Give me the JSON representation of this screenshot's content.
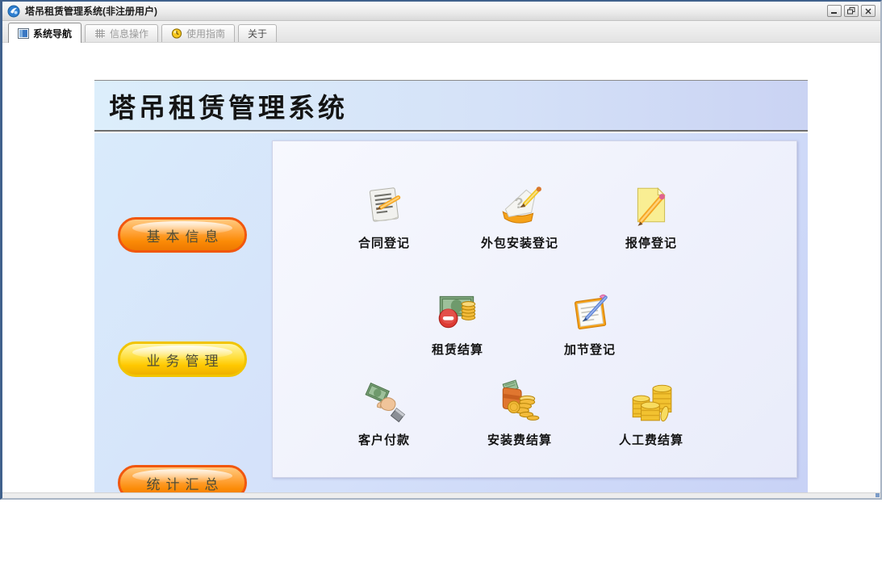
{
  "window": {
    "title": "塔吊租赁管理系统(非注册用户)",
    "app_icon": "blue-globe-icon",
    "controls": [
      {
        "name": "minimize-button",
        "glyph": "−"
      },
      {
        "name": "restore-button",
        "glyph": "❐"
      },
      {
        "name": "close-button",
        "glyph": "×"
      }
    ]
  },
  "tabs": [
    {
      "label": "系统导航",
      "icon": "blue-panel-icon",
      "active": true
    },
    {
      "label": "信息操作",
      "icon": "grid-icon",
      "active": false
    },
    {
      "label": "使用指南",
      "icon": "yellow-ball-icon",
      "active": false
    },
    {
      "label": "关于",
      "icon": "",
      "active": false
    }
  ],
  "banner": {
    "title": "塔吊租赁管理系统"
  },
  "sidebar": {
    "buttons": [
      {
        "label": "基本信息",
        "style": "orange"
      },
      {
        "label": "业务管理",
        "style": "yellow"
      },
      {
        "label": "统计汇总",
        "style": "orange"
      }
    ]
  },
  "grid": {
    "rows": [
      {
        "items": [
          {
            "label": "合同登记",
            "icon": "notepad-pencil-icon"
          },
          {
            "label": "外包安装登记",
            "icon": "paper-question-pencil-icon"
          },
          {
            "label": "报停登记",
            "icon": "yellow-note-pencil-icon"
          }
        ]
      },
      {
        "items": [
          {
            "label": "租赁结算",
            "icon": "banknote-coins-minus-icon"
          },
          {
            "label": "加节登记",
            "icon": "clipboard-pen-icon"
          }
        ]
      },
      {
        "items": [
          {
            "label": "客户付款",
            "icon": "hand-banknote-icon"
          },
          {
            "label": "安装费结算",
            "icon": "wallet-coins-icon"
          },
          {
            "label": "人工费结算",
            "icon": "coin-stacks-icon"
          }
        ]
      }
    ]
  },
  "colors": {
    "banner_gradient_left": "#dceefb",
    "banner_gradient_right": "#cad3f3",
    "body_gradient_start": "#d9ebfb",
    "body_gradient_end": "#c8d2f6",
    "pill_orange_border": "#f1570e",
    "pill_yellow_border": "#f1c400",
    "inner_panel_bg": "#eef0fb"
  }
}
